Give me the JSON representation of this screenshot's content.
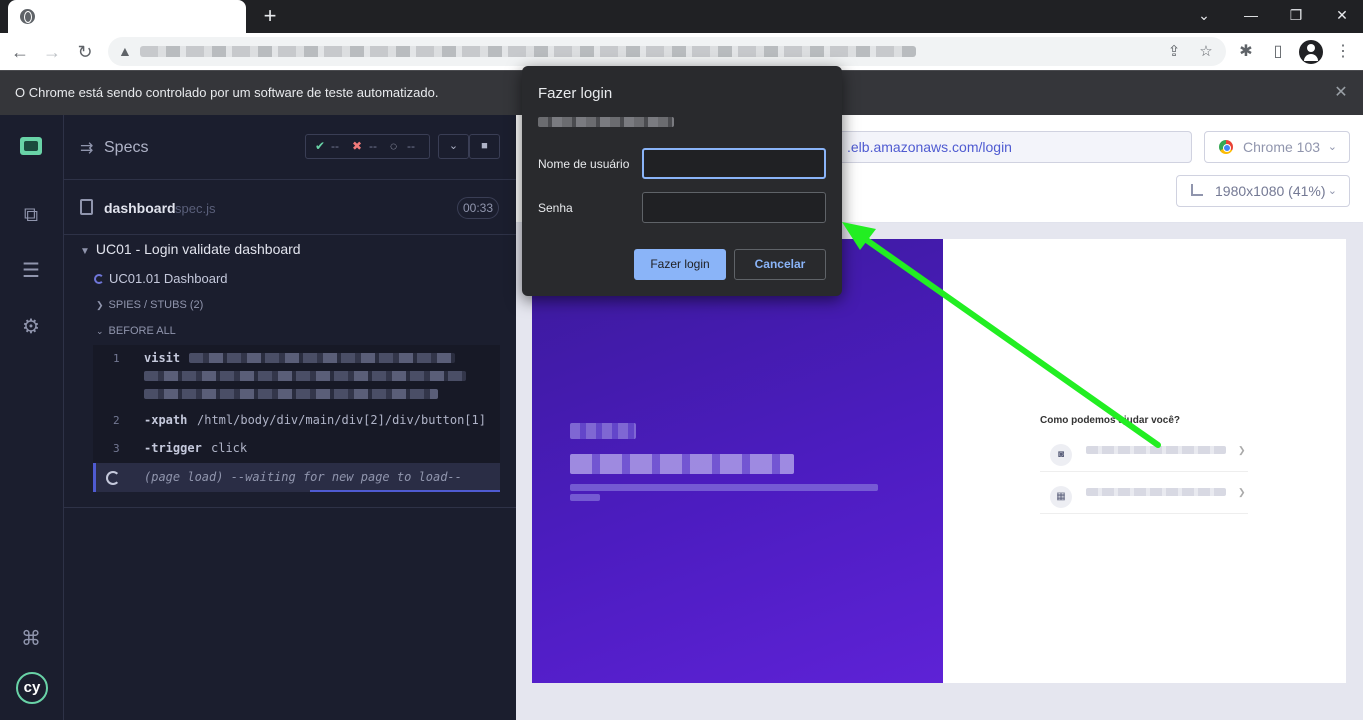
{
  "chrome": {
    "infobar_text": "O Chrome está sendo controlado por um software de teste automatizado."
  },
  "reporter": {
    "specs_title": "Specs",
    "stats": {
      "passed": "--",
      "failed": "--",
      "pending": "--"
    },
    "spec_file": {
      "name": "dashboard",
      "ext": "spec.js",
      "duration": "00:33"
    },
    "suite_title": "UC01 - Login validate dashboard",
    "test_title": "UC01.01 Dashboard",
    "hooks": {
      "spies": "SPIES / STUBS (2)",
      "before_all": "BEFORE ALL"
    },
    "commands": [
      {
        "num": "1",
        "name": "visit",
        "message": ""
      },
      {
        "num": "2",
        "name": "-xpath",
        "message": "/html/body/div/main/div[2]/div/button[1]"
      },
      {
        "num": "3",
        "name": "-trigger",
        "message": "click"
      }
    ],
    "page_load": "(page load)  --waiting for new page to load--"
  },
  "aut": {
    "url": ".elb.amazonaws.com/login",
    "browser": "Chrome 103",
    "viewport": "1980x1080 (41%)",
    "help_title": "Como podemos ajudar você?"
  },
  "dialog": {
    "title": "Fazer login",
    "username_label": "Nome de usuário",
    "username_value": "",
    "password_label": "Senha",
    "password_value": "",
    "login_button": "Fazer login",
    "cancel_button": "Cancelar"
  },
  "colors": {
    "annotation_arrow": "#22ee22",
    "cypress_accent": "#4f5bd1",
    "dialog_primary": "#8ab4f8"
  }
}
